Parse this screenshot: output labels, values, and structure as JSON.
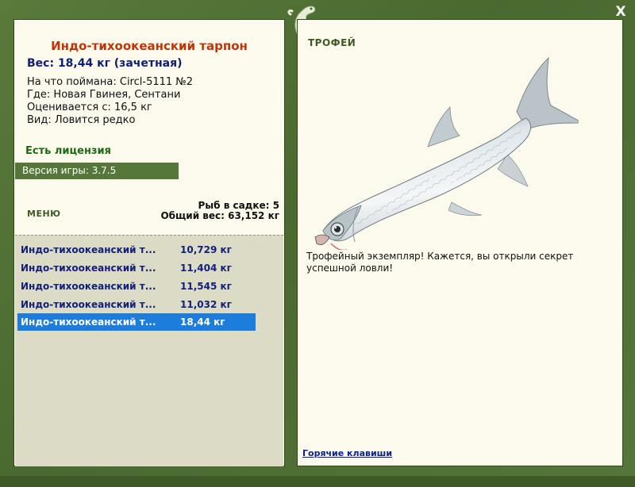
{
  "window": {
    "close_label": "X"
  },
  "fish": {
    "title": "Индо-тихоокеанский тарпон",
    "weight_line": "Вес: 18,44 кг (зачетная)",
    "details": [
      "На что поймана: Circl-5111 №2",
      "Где: Новая Гвинея, Сентани",
      "Оценивается с: 16,5 кг",
      "Вид: Ловится редко"
    ]
  },
  "license": "Есть лицензия",
  "version": "Версия игры: 3.7.5",
  "menu_label": "МЕНЮ",
  "stats": {
    "in_keepnet": "Рыб в садке: 5",
    "total_weight": "Общий вес: 63,152 кг"
  },
  "catches": [
    {
      "name": "Индо-тихоокеанский т...",
      "weight": "10,729 кг",
      "selected": false
    },
    {
      "name": "Индо-тихоокеанский т...",
      "weight": "11,404 кг",
      "selected": false
    },
    {
      "name": "Индо-тихоокеанский т...",
      "weight": "11,545 кг",
      "selected": false
    },
    {
      "name": "Индо-тихоокеанский т...",
      "weight": "11,032 кг",
      "selected": false
    },
    {
      "name": "Индо-тихоокеанский т...",
      "weight": "18,44 кг",
      "selected": true
    }
  ],
  "trophy": {
    "label": "ТРОФЕЙ",
    "text": "Трофейный экземпляр! Кажется, вы открыли секрет успешной ловли!"
  },
  "hotkeys_link": "Горячие клавиши",
  "icons": {
    "close": "close-icon",
    "logo": "lizard-logo-icon",
    "fish": "tarpon-fish-image"
  },
  "colors": {
    "frame": "#4d6a33",
    "panel": "#fbfaec",
    "title": "#c0340a",
    "weight": "#0d1f7a",
    "license": "#1d6b12",
    "selected_row": "#1d7ddc"
  }
}
